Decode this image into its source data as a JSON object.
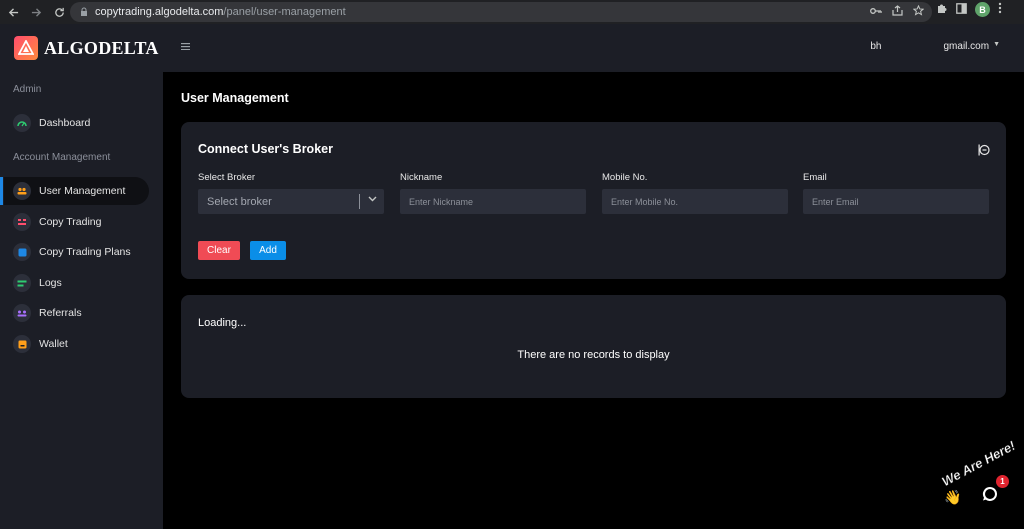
{
  "browser": {
    "url_host": "copytrading.algodelta.com",
    "url_path": "/panel/user-management",
    "profile_initial": "B"
  },
  "brand": {
    "name": "ALGODELTA"
  },
  "sidebar": {
    "sections": [
      {
        "label": "Admin"
      },
      {
        "label": "Account Management"
      }
    ],
    "items": [
      {
        "label": "Dashboard",
        "icon": "gauge-icon",
        "color": "#2ecc71"
      },
      {
        "label": "User Management",
        "icon": "users-icon",
        "color": "#ff9f1a",
        "active": true
      },
      {
        "label": "Copy Trading",
        "icon": "copy-trading-icon",
        "color": "#ff4d6d"
      },
      {
        "label": "Copy Trading Plans",
        "icon": "plans-icon",
        "color": "#1e88e5"
      },
      {
        "label": "Logs",
        "icon": "logs-icon",
        "color": "#2ecc71"
      },
      {
        "label": "Referrals",
        "icon": "referrals-icon",
        "color": "#a970ff"
      },
      {
        "label": "Wallet",
        "icon": "wallet-icon",
        "color": "#ff9f1a"
      }
    ]
  },
  "topbar": {
    "email_prefix": "bh",
    "email_suffix": "gmail.com"
  },
  "main": {
    "title": "User Management",
    "form": {
      "title": "Connect User's Broker",
      "broker": {
        "label": "Select Broker",
        "placeholder": "Select broker"
      },
      "nickname": {
        "label": "Nickname",
        "placeholder": "Enter Nickname"
      },
      "mobile": {
        "label": "Mobile No.",
        "placeholder": "Enter Mobile No."
      },
      "email": {
        "label": "Email",
        "placeholder": "Enter Email"
      },
      "clear_label": "Clear",
      "add_label": "Add"
    },
    "table": {
      "loading_text": "Loading...",
      "empty_text": "There are no records to display"
    }
  },
  "chat": {
    "badge_text": "We Are Here!",
    "unread_count": "1"
  },
  "colors": {
    "accent_blue": "#0a8ee8",
    "danger_red": "#f04b55",
    "panel_bg": "#1c1e26"
  }
}
